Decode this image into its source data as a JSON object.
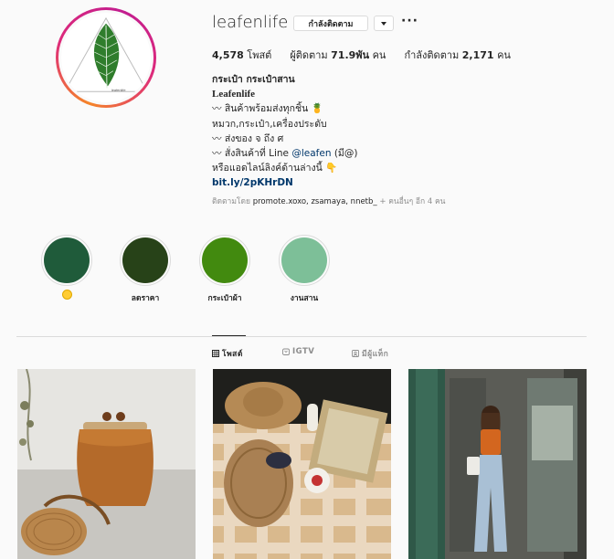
{
  "profile": {
    "username": "leafenlife",
    "follow_label": "กำลังติดตาม",
    "more_label": "···",
    "stats": {
      "posts_count": "4,578",
      "posts_label": "โพสต์",
      "followers_label": "ผู้ติดตาม",
      "followers_count": "71.9พัน",
      "followers_unit": "คน",
      "following_label": "กำลังติดตาม",
      "following_count": "2,171",
      "following_unit": "คน"
    },
    "bio": {
      "full_name": "กระเป๋า กระเป๋าสาน",
      "brand": "Leafenlife",
      "line1": "〰 สินค้าพร้อมส่งทุกชิ้น 🍍",
      "line2": "หมวก,กระเป๋า,เครื่องประดับ",
      "line3": "〰 ส่งของ จ ถึง ศ",
      "line4_prefix": "〰 สั่งสินค้าที่ Line ",
      "line4_mention": "@leafen",
      "line4_suffix": " (มี@)",
      "line5": "หรือแอดไลน์ลิงค์ด้านล่างนี้ 👇",
      "link": "bit.ly/2pKHrDN"
    },
    "followed_by": {
      "prefix": "ติดตามโดย ",
      "names": "promote.xoxo, zsamaya, nnetb_",
      "suffix": " + คนอื่นๆ อีก 4 คน"
    }
  },
  "highlights": [
    {
      "label": "",
      "color": "#1f5b3a"
    },
    {
      "label": "ลดราคา",
      "color": "#274218"
    },
    {
      "label": "กระเป๋าผ้า",
      "color": "#428a0f"
    },
    {
      "label": "งานสาน",
      "color": "#7dbf98"
    }
  ],
  "tabs": [
    {
      "label": "โพสต์",
      "icon": "grid-icon"
    },
    {
      "label": "IGTV",
      "icon": "igtv-icon"
    },
    {
      "label": "มีผู้แท็ก",
      "icon": "tagged-icon"
    }
  ],
  "colors": {
    "text": "#262626",
    "muted": "#8e8e8e",
    "link": "#00376b",
    "border": "#dbdbdb",
    "background": "#fafafa"
  }
}
